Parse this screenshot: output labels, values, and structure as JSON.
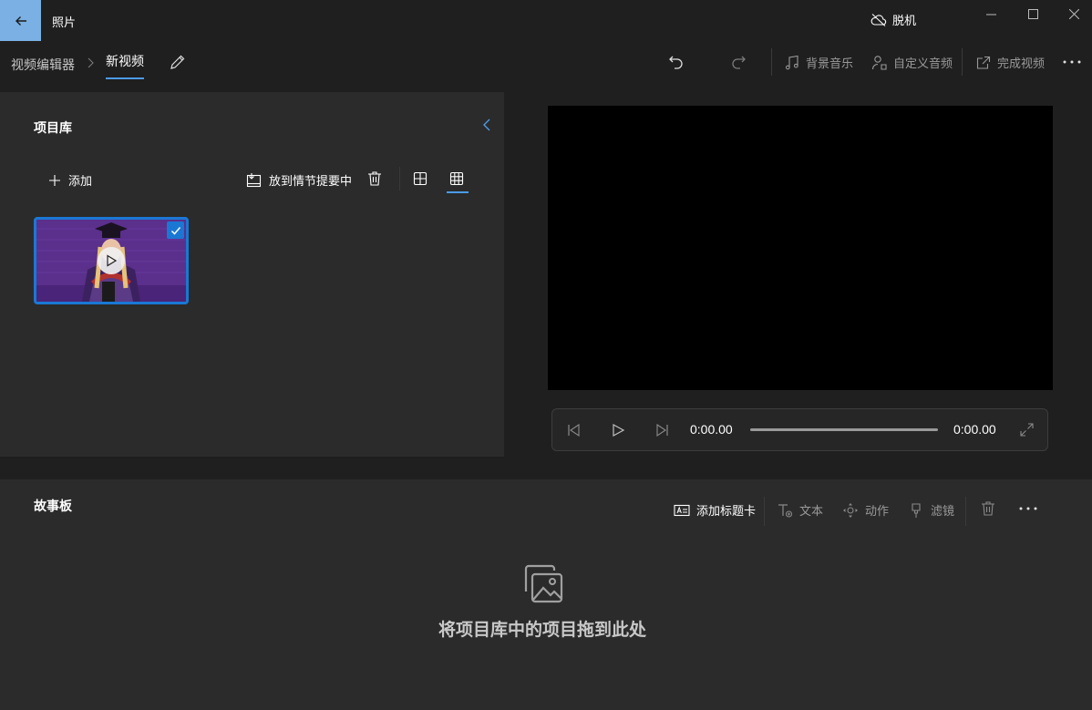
{
  "app": {
    "title": "照片",
    "offline_label": "脱机"
  },
  "breadcrumb": {
    "root": "视频编辑器",
    "current": "新视频"
  },
  "toolbar": {
    "background_music": "背景音乐",
    "custom_audio": "自定义音频",
    "finish_video": "完成视频"
  },
  "library": {
    "title": "项目库",
    "add_label": "添加",
    "place_in_storyboard": "放到情节提要中"
  },
  "player": {
    "current_time": "0:00.00",
    "total_time": "0:00.00",
    "progress": 0
  },
  "storyboard": {
    "title": "故事板",
    "add_title_card": "添加标题卡",
    "text": "文本",
    "motion": "动作",
    "filters": "滤镜",
    "empty_message": "将项目库中的项目拖到此处"
  },
  "colors": {
    "accent": "#1a78d4",
    "back_button": "#7ab0e3",
    "panel": "#2b2b2b",
    "background": "#1f1f1f"
  }
}
